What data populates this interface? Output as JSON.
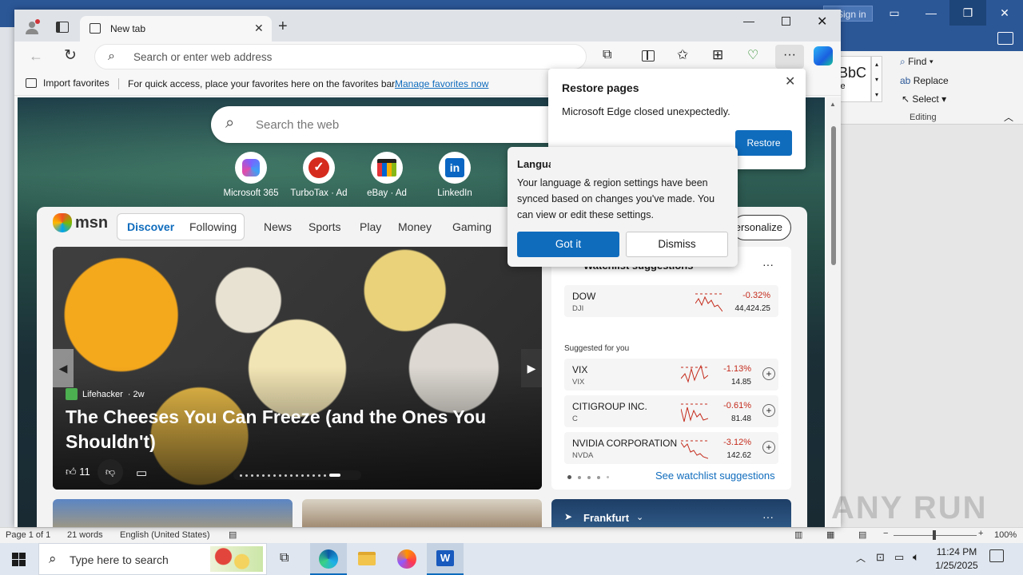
{
  "word": {
    "signin": "Sign in",
    "styles_preview": "BbC",
    "styles_label": "le",
    "editing": {
      "find": "Find",
      "replace": "Replace",
      "select": "Select",
      "group": "Editing"
    },
    "status": {
      "page": "Page 1 of 1",
      "words": "21 words",
      "language": "English (United States)",
      "zoom": "100%"
    }
  },
  "edge": {
    "tab_title": "New tab",
    "address_placeholder": "Search or enter web address",
    "favbar": {
      "import": "Import favorites",
      "message": "For quick access, place your favorites here on the favorites bar.",
      "manage_link": "Manage favorites now"
    }
  },
  "newtab": {
    "search_placeholder": "Search the web",
    "quicklinks": [
      {
        "label": "Microsoft 365",
        "icon": "microsoft365-icon",
        "color": "#7b61ff"
      },
      {
        "label": "TurboTax · Ad",
        "icon": "turbotax-icon",
        "color": "#d52b1e"
      },
      {
        "label": "eBay · Ad",
        "icon": "ebay-icon",
        "color": "#e53238"
      },
      {
        "label": "LinkedIn",
        "icon": "linkedin-icon",
        "color": "#0a66c2"
      }
    ],
    "msn": {
      "logo": "msn",
      "tabs": [
        "Discover",
        "Following"
      ],
      "nav": [
        "News",
        "Sports",
        "Play",
        "Money",
        "Gaming"
      ],
      "personalize": "ersonalize",
      "hero": {
        "source": "Lifehacker",
        "age": "· 2w",
        "title": "The Cheeses You Can Freeze (and the Ones You Shouldn't)",
        "likes": "11"
      },
      "watchlist": {
        "title": "Watchlist suggestions",
        "suggested_label": "Suggested for you",
        "see_more": "See watchlist suggestions",
        "stocks": [
          {
            "name": "DOW",
            "ticker": "DJI",
            "change": "-0.32%",
            "value": "44,424.25"
          },
          {
            "name": "VIX",
            "ticker": "VIX",
            "change": "-1.13%",
            "value": "14.85"
          },
          {
            "name": "CITIGROUP INC.",
            "ticker": "C",
            "change": "-0.61%",
            "value": "81.48"
          },
          {
            "name": "NVIDIA CORPORATION",
            "ticker": "NVDA",
            "change": "-3.12%",
            "value": "142.62"
          }
        ]
      },
      "weather_city": "Frankfurt"
    }
  },
  "restore_popup": {
    "title": "Restore pages",
    "message": "Microsoft Edge closed unexpectedly.",
    "button": "Restore"
  },
  "lang_popup": {
    "title": "Language and region changed",
    "message": "Your language & region settings have been synced based on changes you've made. You can view or edit these settings.",
    "ok": "Got it",
    "dismiss": "Dismiss"
  },
  "taskbar": {
    "search_placeholder": "Type here to search",
    "time": "11:24 PM",
    "date": "1/25/2025"
  },
  "watermark": "ANY RUN",
  "colors": {
    "accent": "#0f6cbd",
    "negative": "#c42b1c",
    "word_blue": "#2b5797"
  }
}
